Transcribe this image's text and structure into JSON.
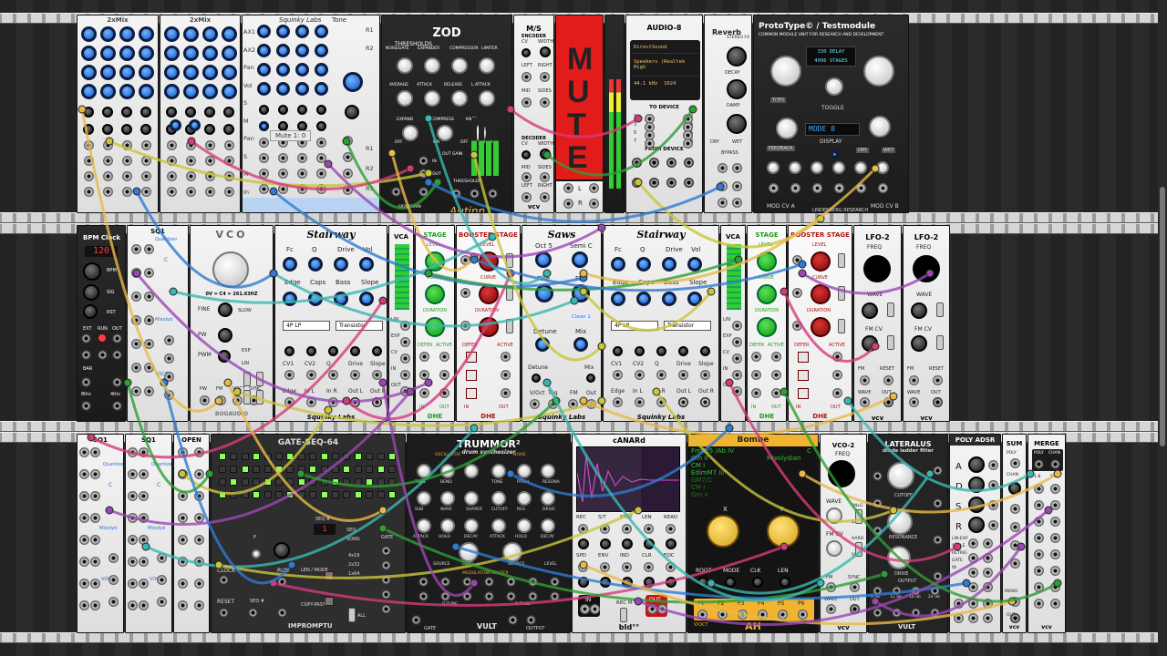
{
  "rack": {
    "row1": {
      "fmod1": {
        "title": "2xMix"
      },
      "fmod2": {
        "title": "2xMix"
      },
      "sq_mixer": {
        "title": "Squinky Labs",
        "title2": "Tone",
        "left_labels": [
          "AX1",
          "AX2",
          "Pan",
          "Vol",
          "S",
          "M",
          "Pan",
          "S",
          "M",
          "In",
          "Out"
        ],
        "right_labels": [
          "R1",
          "R2",
          "R1",
          "R2",
          "R3",
          "R4"
        ]
      },
      "zod": {
        "title": "ZOD",
        "subtitle": "THRESHOLDS",
        "row1": [
          "NOISEGATE",
          "EXPANDER",
          "COMPRESSOR",
          "LIMITER"
        ],
        "row2": [
          "AVERAGE",
          "ATTACK",
          "RELEASE",
          "L.ATTACK"
        ],
        "row3": [
          "EXPAND",
          "COMPRESS",
          "KNEE"
        ],
        "misc": [
          "OFF",
          "ON",
          "OFF",
          "HARD",
          "OUT GAIN",
          "IN",
          "OUT",
          "THRESHOLDS",
          "SIDECHAIN"
        ],
        "brand": "Autinn"
      },
      "ms": {
        "title": "M/S",
        "encoder": "ENCODER",
        "decoder": "DECODER",
        "labels": [
          "CV",
          "WIDTH",
          "LEFT",
          "RIGHT",
          "MID",
          "SIDES",
          "CV",
          "WIDTH",
          "MID",
          "SIDES",
          "LEFT",
          "RIGHT"
        ],
        "brand": "vcv"
      },
      "mute": {
        "text": "MUTE",
        "l": "L",
        "r": "R"
      },
      "audio8": {
        "title": "AUDIO-8",
        "driver": "DirectSound",
        "device": "Speakers (Realtek High",
        "rate": "44.1 kHz",
        "block": "1024",
        "to_device": "TO DEVICE",
        "from_device": "FROM DEVICE",
        "ports_to": [
          "1",
          "2",
          "3",
          "4",
          "5",
          "6",
          "7",
          "8"
        ],
        "ports_from": [
          "1",
          "2",
          "3",
          "4",
          "5",
          "6",
          "7",
          "8"
        ],
        "brand": "vcv"
      },
      "reverb": {
        "title": "Reverb",
        "subtitle": "STEREO FX",
        "labels": [
          "DECAY",
          "DAMP",
          "DRY",
          "WET",
          "BYPASS"
        ]
      },
      "prototype": {
        "title": "ProtoType© / Testmodule",
        "subtitle": "COMMON MODULE UNIT FOR RESEARCH AND DEVELOPMENT",
        "lcd1": "330 DELAY",
        "lcd2": "4096 STAGES",
        "lcd3": "MODE 8",
        "label_tp": "T(TP)",
        "toggle": "TOGGLE",
        "display": "DISPLAY",
        "feedback": "FEEDBACK",
        "dry": "DRY",
        "wet": "WET",
        "mod_a": "MOD CV A",
        "mod_b": "MOD CV B",
        "brand": "LINDENBERG RESEARCH"
      },
      "tooltip": "Mute 1: 0"
    },
    "row2": {
      "bpm": {
        "title": "BPM Clock",
        "display": "120",
        "labels": [
          "BPM",
          "SIG",
          "RST",
          "EXT",
          "RUN",
          "OUT",
          "BAR",
          "8ths",
          "4ths"
        ]
      },
      "sq1a": {
        "title": "SQ1",
        "labels": [
          "Quantizer",
          "C",
          "Mixolyd",
          "VOCT"
        ]
      },
      "vco": {
        "title": "VCO",
        "freq": "0V = C4 = 261.63HZ",
        "labels": [
          "FINE",
          "SLOW",
          "PW",
          "PWM",
          "EXP",
          "LIN"
        ],
        "ports": [
          "PW",
          "FM",
          "VOCT",
          "SYNC"
        ],
        "brand": "BOGAUDIO"
      },
      "stairway1": {
        "title": "Stairway",
        "knobs": [
          "Fc",
          "Q",
          "Drive",
          "Vol",
          "Edge",
          "Caps",
          "Bass",
          "Slope"
        ],
        "mode": "4P LP",
        "type": "Transistor",
        "cv": [
          "CV1",
          "CV2",
          "Q",
          "Drive",
          "Slope",
          "Edge",
          "In L",
          "In R",
          "Out L",
          "Out R"
        ],
        "brand": "Squinky Labs"
      },
      "vca1": {
        "title": "VCA",
        "labels": [
          "LIN",
          "EXP",
          "CV",
          "IN",
          "OUT"
        ]
      },
      "stage1": {
        "title": "STAGE",
        "labels": [
          "LEVEL",
          "CURVE",
          "DURATION",
          "DEFER",
          "ACTIVE",
          "IN",
          "OUT"
        ],
        "brand": "DHE"
      },
      "booster1": {
        "title": "BOOSTER STAGE",
        "labels": [
          "LEVEL",
          "CURVE",
          "DURATION",
          "DEFER",
          "ACTIVE",
          "IN",
          "OUT"
        ],
        "brand": "DHE"
      },
      "saws": {
        "title": "Saws",
        "labels": [
          "Oct 5",
          "Semi C",
          "Fine",
          "FM",
          "Detune",
          "Mix",
          "Detune",
          "Mix",
          "Trig",
          "V/Oct",
          "FM",
          "Out"
        ],
        "note": "Clean 1",
        "brand": "Squinky Labs"
      },
      "stairway2": {
        "title": "Stairway",
        "knobs": [
          "Fc",
          "Q",
          "Drive",
          "Vol",
          "Edge",
          "Caps",
          "Bass",
          "Slope"
        ],
        "mode": "4P LP",
        "type": "Transistor",
        "cv": [
          "CV1",
          "CV2",
          "Q",
          "Drive",
          "Slope",
          "Edge",
          "In L",
          "In R",
          "Out L",
          "Out R"
        ],
        "brand": "Squinky Labs"
      },
      "vca2": {
        "title": "VCA",
        "labels": [
          "LIN",
          "EXP",
          "CV",
          "IN",
          "OUT"
        ]
      },
      "stage2": {
        "title": "STAGE",
        "labels": [
          "LEVEL",
          "CURVE",
          "DURATION",
          "DEFER",
          "ACTIVE",
          "IN",
          "OUT"
        ],
        "brand": "DHE"
      },
      "booster2": {
        "title": "BOOSTER STAGE",
        "labels": [
          "LEVEL",
          "CURVE",
          "DURATION",
          "DEFER",
          "ACTIVE",
          "IN",
          "OUT"
        ],
        "brand": "DHE"
      },
      "lfo1": {
        "title": "LFO-2",
        "labels": [
          "FREQ",
          "WAVE",
          "FM CV",
          "FM",
          "RESET",
          "WAVE",
          "OUT"
        ],
        "brand": "vcv"
      },
      "lfo2": {
        "title": "LFO-2",
        "labels": [
          "FREQ",
          "WAVE",
          "FM CV",
          "FM",
          "RESET",
          "WAVE",
          "OUT"
        ],
        "brand": "vcv"
      }
    },
    "row3": {
      "sq1b": {
        "title": "SQ1",
        "labels": [
          "Quantize",
          "C",
          "Mixolyd",
          "VOCT"
        ]
      },
      "sq1c": {
        "title": "SQ1",
        "labels": [
          "Quantize",
          "C",
          "Mixolyd",
          "VOCT"
        ]
      },
      "open": {
        "title": "OPEN"
      },
      "gateseq": {
        "title": "GATE-SEQ-64",
        "labels": [
          "SEQ #",
          "SEQ",
          "SONG",
          "4x16",
          "2x32",
          "1x64",
          "LEN / MODE",
          "COPY-PASTE",
          "CLOCK",
          "RESET",
          "RUN",
          "SEQ #",
          "GATE",
          "P",
          "ALL"
        ],
        "brand": "IMPROMPTU"
      },
      "trummor": {
        "title": "TRUMMOR²",
        "subtitle": "drum synthesizer",
        "labels": [
          "OSCILLATOR",
          "NOISE",
          "TUNE",
          "BEND",
          "TONE",
          "PITCH",
          "RESONANCE",
          "SUB",
          "WAVE",
          "SHAPER",
          "CUTOFF",
          "ATTACK",
          "HOLD",
          "DECAY",
          "SOURCE",
          "LEVEL",
          "MODULATION ROUTER",
          "D-TUNE",
          "OUTPUT",
          "GATE"
        ],
        "brand": "VULT"
      },
      "canard": {
        "title": "cANARd",
        "labels": [
          "REC",
          "S/T",
          "STRT",
          "LEN",
          "READ",
          "SPD",
          "ENV",
          "IND",
          "CLR",
          "EOC",
          "IN",
          "REC M",
          "OUT",
          "L",
          "R"
        ],
        "brand": "bId°°"
      },
      "bombe": {
        "title": "Bombe",
        "chord_lines": [
          "Fm9b5 /Ab IV",
          "Gm II",
          "CM I",
          "EdimM7 iii°",
          "GM7/C",
          "CM I",
          "Gm v"
        ],
        "key": "C",
        "mode": "Mixolydian",
        "knobs": [
          "X",
          "Y"
        ],
        "labels": [
          "ROOT",
          "MODE",
          "CLK",
          "LEN"
        ],
        "outs": [
          "P1",
          "P2",
          "P3",
          "P4",
          "P5",
          "P6"
        ],
        "voct": "V/OCT",
        "brand": "AH"
      },
      "vco2": {
        "title": "VCO-2",
        "labels": [
          "FREQ",
          "WAVE",
          "ANLG",
          "DIGI",
          "FM CV",
          "HARD",
          "SOFT",
          "FM",
          "SYNC",
          "WAVE",
          "OUT"
        ],
        "brand": "vcv"
      },
      "lateralus": {
        "title": "LATERALUS",
        "subtitle": "diode ladder filter",
        "labels": [
          "CUTOFF",
          "RESONANCE",
          "DRIVE",
          "OUTPUT",
          "6 db",
          "12 db",
          "18 db",
          "24 db"
        ],
        "brand": "VULT"
      },
      "adsr": {
        "title": "POLY ADSR",
        "labels": [
          "A",
          "D",
          "S",
          "R",
          "LIN-EXP",
          "SCALE",
          "RETRIG",
          "GATE",
          "IN"
        ]
      },
      "sum": {
        "title": "SUM",
        "labels": [
          "POLY",
          "CHAN",
          "MONO",
          "OUT"
        ],
        "brand": "vcv"
      },
      "merge": {
        "title": "MERGE",
        "labels": [
          "POLY",
          "CHAN",
          "1-8",
          "9-16"
        ],
        "brand": "vcv"
      }
    }
  },
  "cable_colors": [
    "#c9c53a",
    "#d43b7a",
    "#2f9e35",
    "#2f7bd1",
    "#e8b94a",
    "#9b47b3",
    "#3bb6b0"
  ]
}
